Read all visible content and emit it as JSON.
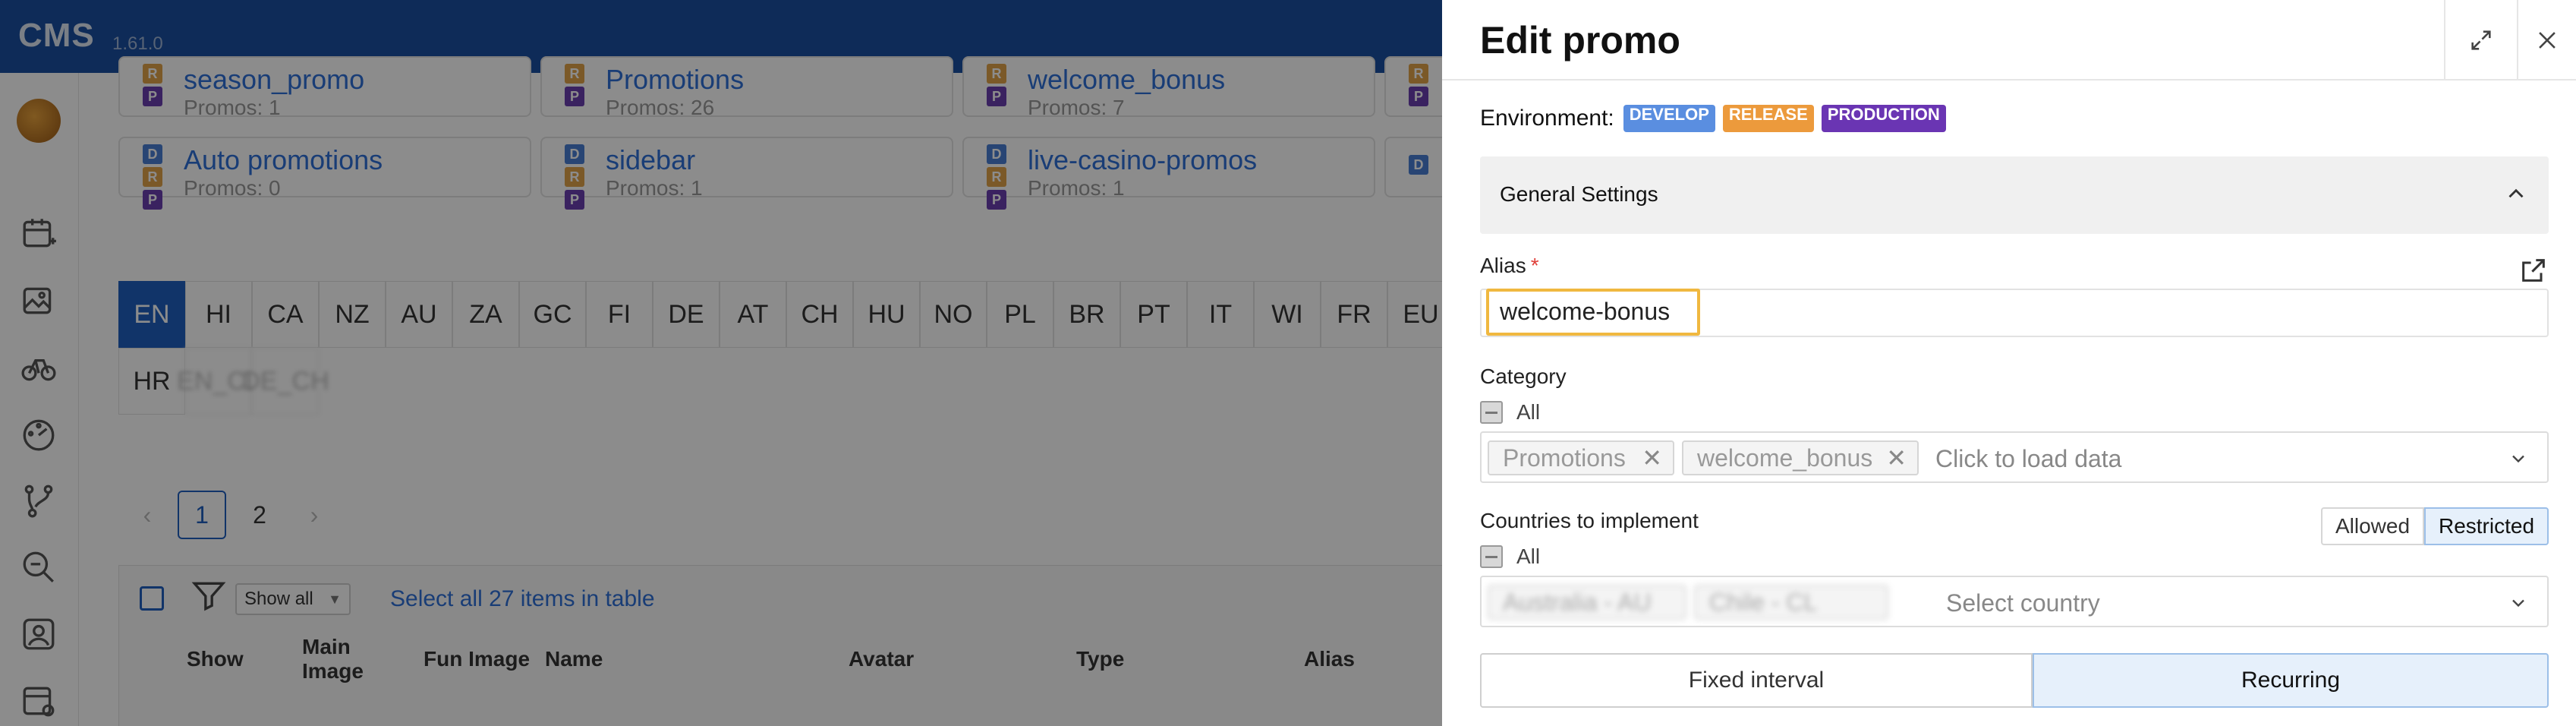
{
  "app": {
    "logo": "CMS",
    "version": "1.61.0",
    "sidebar_icons": [
      "calendar-add-icon",
      "image-gallery-icon",
      "bicycle-icon",
      "dashboard-gauge-icon",
      "branch-icon",
      "search-zoom-icon",
      "user-account-icon",
      "settings-panel-icon"
    ]
  },
  "cards": [
    {
      "name": "season_promo",
      "count": "Promos: 1"
    },
    {
      "name": "Promotions",
      "count": "Promos: 26"
    },
    {
      "name": "welcome_bonus",
      "count": "Promos: 7"
    },
    {
      "name": "",
      "count": ""
    },
    {
      "name": "Auto promotions",
      "count": "Promos: 0"
    },
    {
      "name": "sidebar",
      "count": "Promos: 1"
    },
    {
      "name": "live-casino-promos",
      "count": "Promos: 1"
    },
    {
      "name": "",
      "count": ""
    }
  ],
  "tag_letters": {
    "d": "D",
    "r": "R",
    "p": "P"
  },
  "languages": [
    "EN",
    "HI",
    "CA",
    "NZ",
    "AU",
    "ZA",
    "GC",
    "FI",
    "DE",
    "AT",
    "CH",
    "HU",
    "NO",
    "PL",
    "BR",
    "PT",
    "IT",
    "WI",
    "FR",
    "EU"
  ],
  "languages_row2": [
    "HR",
    "EN_CL",
    "DE_CH"
  ],
  "pagination": {
    "prev": "‹",
    "pages": [
      "1",
      "2"
    ],
    "next": "›"
  },
  "table": {
    "show_all": "Show all",
    "select_all": "Select all 27 items in table",
    "columns": [
      "Show",
      "Main Image",
      "Fun Image",
      "Name",
      "Avatar",
      "Type",
      "Alias"
    ]
  },
  "drawer": {
    "title": "Edit promo",
    "environment_label": "Environment:",
    "environments": [
      "DEVELOP",
      "RELEASE",
      "PRODUCTION"
    ],
    "section_title": "General Settings",
    "alias_label": "Alias",
    "alias_required": "*",
    "alias_value": "welcome-bonus",
    "category_label": "Category",
    "all_label": "All",
    "category_chips": [
      "Promotions",
      "welcome_bonus"
    ],
    "category_placeholder": "Click to load data",
    "countries_label": "Countries to implement",
    "countries_all": "All",
    "country_chips": [
      "Australia - AU",
      "Chile - CL"
    ],
    "country_placeholder": "Select country",
    "mode_options": [
      "Allowed",
      "Restricted"
    ],
    "mode_selected": "Restricted",
    "schedule_options": [
      "Fixed interval",
      "Recurring"
    ],
    "schedule_selected": "Recurring"
  }
}
